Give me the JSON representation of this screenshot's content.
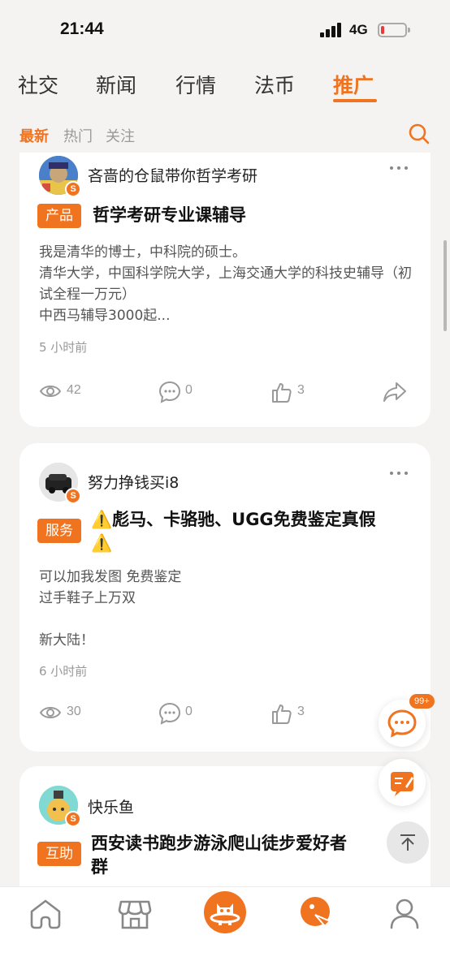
{
  "status_bar": {
    "time": "21:44",
    "network": "4G",
    "battery_level": 0.1
  },
  "main_tabs": [
    {
      "label": "社交",
      "active": false
    },
    {
      "label": "新闻",
      "active": false
    },
    {
      "label": "行情",
      "active": false
    },
    {
      "label": "法币",
      "active": false
    },
    {
      "label": "推广",
      "active": true
    }
  ],
  "sub_tabs": [
    {
      "label": "最新",
      "active": true
    },
    {
      "label": "热门",
      "active": false
    },
    {
      "label": "关注",
      "active": false
    }
  ],
  "posts": [
    {
      "username": "吝啬的仓鼠带你哲学考研",
      "tag": "产品",
      "title": "哲学考研专业课辅导",
      "body": "我是清华的博士，中科院的硕士。\n清华大学，中国科学院大学，上海交通大学的科技史辅导（初试全程一万元）\n中西马辅导3000起...",
      "time": "5 小时前",
      "views": "42",
      "comments": "0",
      "likes": "3"
    },
    {
      "username": "努力挣钱买i8",
      "tag": "服务",
      "title_line1": "⚠️彪马、卡骆驰、UGG免费鉴定真假",
      "title_line2": "⚠️",
      "body": "可以加我发图 免费鉴定\n过手鞋子上万双\n\n新大陆！",
      "time": "6 小时前",
      "views": "30",
      "comments": "0",
      "likes": "3"
    },
    {
      "username": "快乐鱼",
      "tag": "互助",
      "title_line1": "西安读书跑步游泳爬山徒步爱好者",
      "title_line2": "群"
    }
  ],
  "floating": {
    "chat_badge": "99+"
  },
  "colors": {
    "accent": "#f07320",
    "background": "#f4f3f2"
  },
  "icons": {
    "bottom_nav": [
      "home-icon",
      "market-icon",
      "planet-cat-icon",
      "promo-icon",
      "profile-icon"
    ]
  }
}
